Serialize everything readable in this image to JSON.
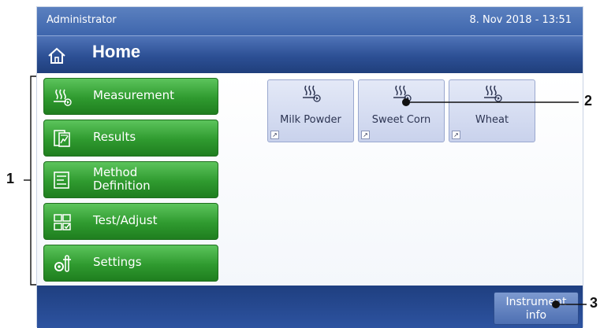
{
  "status": {
    "user": "Administrator",
    "datetime": "8. Nov 2018 - 13:51"
  },
  "header": {
    "title": "Home",
    "icon": "home-icon"
  },
  "menu": [
    {
      "label": "Measurement",
      "icon": "heating-play-icon"
    },
    {
      "label": "Results",
      "icon": "results-document-icon"
    },
    {
      "label_line1": "Method",
      "label_line2": "Definition",
      "icon": "method-definition-icon"
    },
    {
      "label": "Test/Adjust",
      "icon": "test-adjust-icon"
    },
    {
      "label": "Settings",
      "icon": "settings-icon"
    }
  ],
  "shortcuts": [
    {
      "label": "Milk Powder",
      "icon": "heating-play-icon"
    },
    {
      "label": "Sweet Corn",
      "icon": "heating-play-icon"
    },
    {
      "label": "Wheat",
      "icon": "heating-play-icon"
    }
  ],
  "footer": {
    "info_line1": "Instrument",
    "info_line2": "info"
  },
  "callouts": {
    "one": "1",
    "two": "2",
    "three": "3"
  },
  "colors": {
    "menu_green": "#2f9a2f",
    "header_blue": "#2c4f94",
    "shortcut_bg": "#d6ddf0"
  }
}
